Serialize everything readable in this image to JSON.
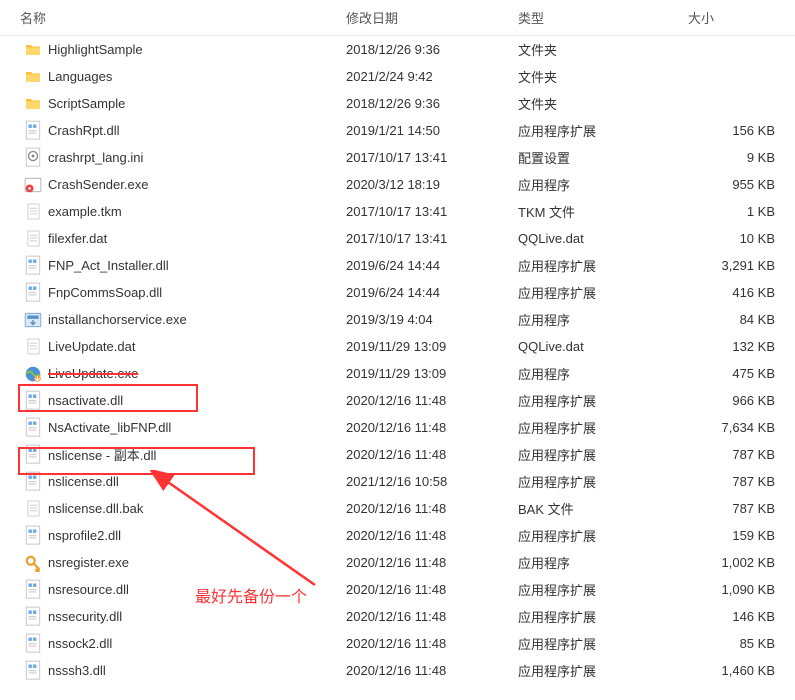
{
  "header": {
    "name": "名称",
    "date": "修改日期",
    "type": "类型",
    "size": "大小"
  },
  "rows": [
    {
      "icon": "folder-yellow",
      "name": "HighlightSample",
      "date": "2018/12/26 9:36",
      "type": "文件夹",
      "size": ""
    },
    {
      "icon": "folder-yellow",
      "name": "Languages",
      "date": "2021/2/24 9:42",
      "type": "文件夹",
      "size": ""
    },
    {
      "icon": "folder-yellow",
      "name": "ScriptSample",
      "date": "2018/12/26 9:36",
      "type": "文件夹",
      "size": ""
    },
    {
      "icon": "file-dll",
      "name": "CrashRpt.dll",
      "date": "2019/1/21 14:50",
      "type": "应用程序扩展",
      "size": "156 KB"
    },
    {
      "icon": "file-ini",
      "name": "crashrpt_lang.ini",
      "date": "2017/10/17 13:41",
      "type": "配置设置",
      "size": "9 KB"
    },
    {
      "icon": "file-exe-red",
      "name": "CrashSender.exe",
      "date": "2020/3/12 18:19",
      "type": "应用程序",
      "size": "955 KB"
    },
    {
      "icon": "file-generic",
      "name": "example.tkm",
      "date": "2017/10/17 13:41",
      "type": "TKM 文件",
      "size": "1 KB"
    },
    {
      "icon": "file-generic",
      "name": "filexfer.dat",
      "date": "2017/10/17 13:41",
      "type": "QQLive.dat",
      "size": "10 KB"
    },
    {
      "icon": "file-dll",
      "name": "FNP_Act_Installer.dll",
      "date": "2019/6/24 14:44",
      "type": "应用程序扩展",
      "size": "3,291 KB"
    },
    {
      "icon": "file-dll",
      "name": "FnpCommsSoap.dll",
      "date": "2019/6/24 14:44",
      "type": "应用程序扩展",
      "size": "416 KB"
    },
    {
      "icon": "file-exe-install",
      "name": "installanchorservice.exe",
      "date": "2019/3/19 4:04",
      "type": "应用程序",
      "size": "84 KB"
    },
    {
      "icon": "file-generic",
      "name": "LiveUpdate.dat",
      "date": "2019/11/29 13:09",
      "type": "QQLive.dat",
      "size": "132 KB"
    },
    {
      "icon": "file-exe-globe",
      "name": "LiveUpdate.exe",
      "date": "2019/11/29 13:09",
      "type": "应用程序",
      "size": "475 KB",
      "strike": true
    },
    {
      "icon": "file-dll",
      "name": "nsactivate.dll",
      "date": "2020/12/16 11:48",
      "type": "应用程序扩展",
      "size": "966 KB"
    },
    {
      "icon": "file-dll",
      "name": "NsActivate_libFNP.dll",
      "date": "2020/12/16 11:48",
      "type": "应用程序扩展",
      "size": "7,634 KB"
    },
    {
      "icon": "file-dll",
      "name": "nslicense - 副本.dll",
      "date": "2020/12/16 11:48",
      "type": "应用程序扩展",
      "size": "787 KB"
    },
    {
      "icon": "file-dll",
      "name": "nslicense.dll",
      "date": "2021/12/16 10:58",
      "type": "应用程序扩展",
      "size": "787 KB"
    },
    {
      "icon": "file-generic",
      "name": "nslicense.dll.bak",
      "date": "2020/12/16 11:48",
      "type": "BAK 文件",
      "size": "787 KB"
    },
    {
      "icon": "file-dll",
      "name": "nsprofile2.dll",
      "date": "2020/12/16 11:48",
      "type": "应用程序扩展",
      "size": "159 KB"
    },
    {
      "icon": "file-exe-key",
      "name": "nsregister.exe",
      "date": "2020/12/16 11:48",
      "type": "应用程序",
      "size": "1,002 KB"
    },
    {
      "icon": "file-dll",
      "name": "nsresource.dll",
      "date": "2020/12/16 11:48",
      "type": "应用程序扩展",
      "size": "1,090 KB"
    },
    {
      "icon": "file-dll",
      "name": "nssecurity.dll",
      "date": "2020/12/16 11:48",
      "type": "应用程序扩展",
      "size": "146 KB"
    },
    {
      "icon": "file-dll",
      "name": "nssock2.dll",
      "date": "2020/12/16 11:48",
      "type": "应用程序扩展",
      "size": "85 KB"
    },
    {
      "icon": "file-dll",
      "name": "nsssh3.dll",
      "date": "2020/12/16 11:48",
      "type": "应用程序扩展",
      "size": "1,460 KB"
    }
  ],
  "annotation": {
    "text": "最好先备份一个"
  }
}
